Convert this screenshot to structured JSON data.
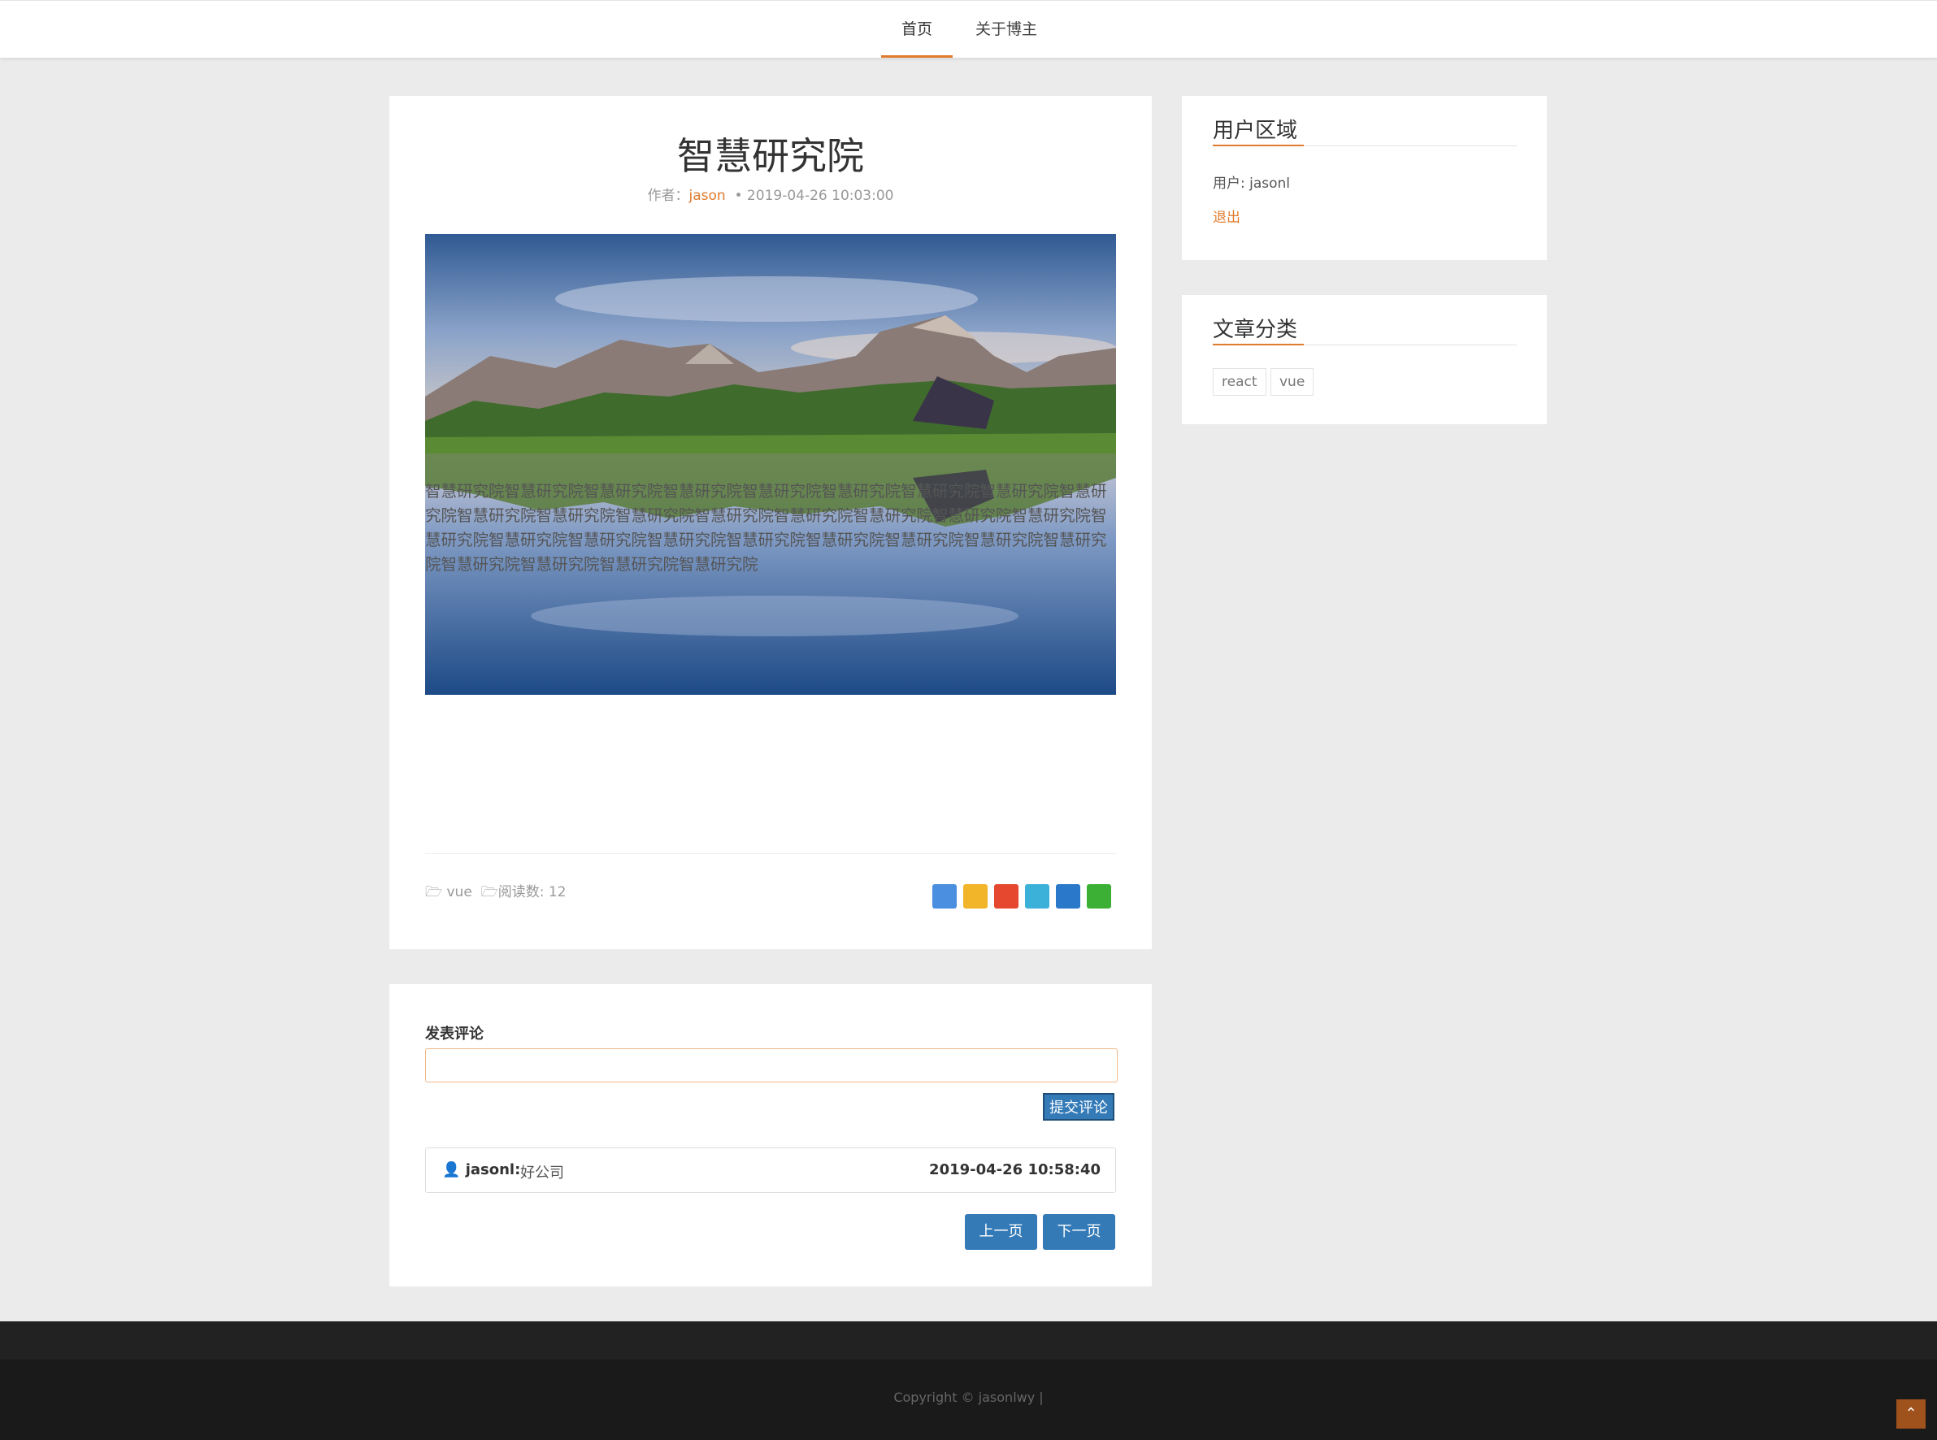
{
  "nav": {
    "items": [
      "首页",
      "关于博主"
    ],
    "active_index": 0
  },
  "article": {
    "title": "智慧研究院",
    "author_label": "作者：",
    "author": "jason",
    "date": "• 2019-04-26 10:03:00",
    "body": "智慧研究院智慧研究院智慧研究院智慧研究院智慧研究院智慧研究院智慧研究院智慧研究院智慧研究院智慧研究院智慧研究院智慧研究院智慧研究院智慧研究院智慧研究院智慧研究院智慧研究院智慧研究院智慧研究院智慧研究院智慧研究院智慧研究院智慧研究院智慧研究院智慧研究院智慧研究院智慧研究院智慧研究院智慧研究院智慧研究院",
    "category": "vue",
    "reads": "阅读数: 12"
  },
  "share_icons": [
    "more-share-icon",
    "qzone-icon",
    "weibo-icon",
    "tencent-weibo-icon",
    "renren-icon",
    "wechat-icon"
  ],
  "comment": {
    "heading": "发表评论",
    "input_value": "",
    "submit_label": "提交评论",
    "items": [
      {
        "user": "jasonl:",
        "text": "好公司",
        "time": "2019-04-26 10:58:40"
      }
    ],
    "prev_label": "上一页",
    "next_label": "下一页"
  },
  "sidebar": {
    "user_area": {
      "title": "用户区域",
      "user_line": "用户: jasonl",
      "logout": "退出"
    },
    "categories": {
      "title": "文章分类",
      "tags": [
        "react",
        "vue"
      ]
    }
  },
  "footer": {
    "copyright": "Copyright © jasonlwy   |"
  },
  "colors": {
    "accent": "#e07b2e",
    "button": "#337ab7",
    "footer": "#1a1a1a"
  }
}
